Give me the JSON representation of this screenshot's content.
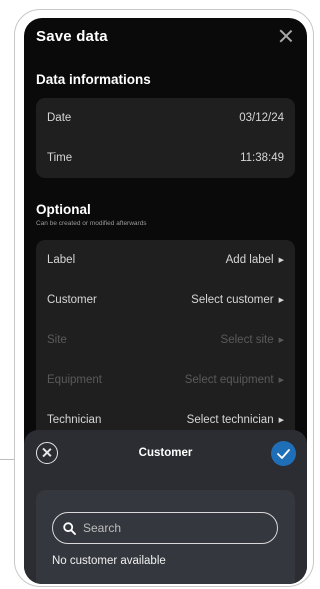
{
  "header": {
    "title": "Save data"
  },
  "data_section": {
    "title": "Data informations",
    "rows": [
      {
        "label": "Date",
        "value": "03/12/24"
      },
      {
        "label": "Time",
        "value": "11:38:49"
      }
    ]
  },
  "optional_section": {
    "title": "Optional",
    "subtitle": "Can be created or modified afterwards",
    "rows": [
      {
        "label": "Label",
        "value": "Add label",
        "enabled": true
      },
      {
        "label": "Customer",
        "value": "Select customer",
        "enabled": true
      },
      {
        "label": "Site",
        "value": "Select site",
        "enabled": false
      },
      {
        "label": "Equipment",
        "value": "Select equipment",
        "enabled": false
      },
      {
        "label": "Technician",
        "value": "Select technician",
        "enabled": true
      }
    ]
  },
  "sheet": {
    "title": "Customer",
    "search_placeholder": "Search",
    "empty_text": "No customer available"
  },
  "colors": {
    "screen_bg": "#0a0a0a",
    "card_bg": "#1f1f1f",
    "sheet_bg": "#2b2d32",
    "accent": "#1f6fb8"
  },
  "icons": {
    "close": "close-icon",
    "caret": "caret-right-icon",
    "confirm": "check-icon",
    "search": "search-icon"
  }
}
